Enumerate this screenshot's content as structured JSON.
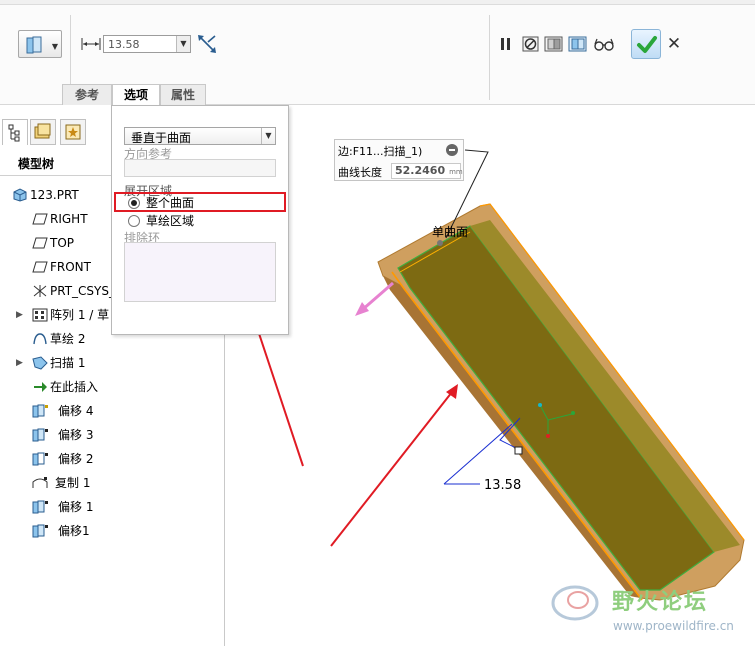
{
  "dashboard": {
    "thickness_value": "13.58",
    "tabs": [
      {
        "label": "参考"
      },
      {
        "label": "选项",
        "active": true
      },
      {
        "label": "属性"
      }
    ]
  },
  "model_tree": {
    "title": "模型树",
    "items": [
      {
        "label": "123.PRT",
        "icon": "part-icon"
      },
      {
        "label": "RIGHT",
        "icon": "datum-plane-icon"
      },
      {
        "label": "TOP",
        "icon": "datum-plane-icon"
      },
      {
        "label": "FRONT",
        "icon": "datum-plane-icon"
      },
      {
        "label": "PRT_CSYS_",
        "icon": "csys-icon"
      },
      {
        "label": "阵列 1 / 草",
        "icon": "pattern-icon",
        "expandable": true
      },
      {
        "label": "草绘 2",
        "icon": "sketch-icon"
      },
      {
        "label": "扫描 1",
        "icon": "sweep-icon",
        "expandable": true
      },
      {
        "label": "在此插入",
        "icon": "insert-here-icon"
      },
      {
        "label": "偏移 4",
        "icon": "offset-icon"
      },
      {
        "label": "偏移 3",
        "icon": "offset-icon"
      },
      {
        "label": "偏移 2",
        "icon": "offset-icon"
      },
      {
        "label": "复制 1",
        "icon": "copy-icon"
      },
      {
        "label": "偏移 1",
        "icon": "offset-icon"
      },
      {
        "label": "偏移1",
        "icon": "offset-icon"
      }
    ]
  },
  "options_panel": {
    "method": "垂直于曲面",
    "direction_ref_label": "方向参考",
    "spread_area_label": "展开区域",
    "radio_whole_surface": "整个曲面",
    "radio_sketch_area": "草绘区域",
    "exclude_loops_label": "排除环"
  },
  "graphics": {
    "callout_edge": "边:F11...扫描_1)",
    "callout_length_label": "曲线长度",
    "callout_length_value": "52.2460",
    "callout_unit": "mm",
    "surface_label": "单曲面",
    "dimension_value": "13.58"
  },
  "watermark": {
    "brand": "野火论坛",
    "url": "www.proewildfire.cn"
  },
  "colors": {
    "highlight_box": "#e01b24",
    "arrow": "#e01b24",
    "confirm": "#2aa63a"
  }
}
